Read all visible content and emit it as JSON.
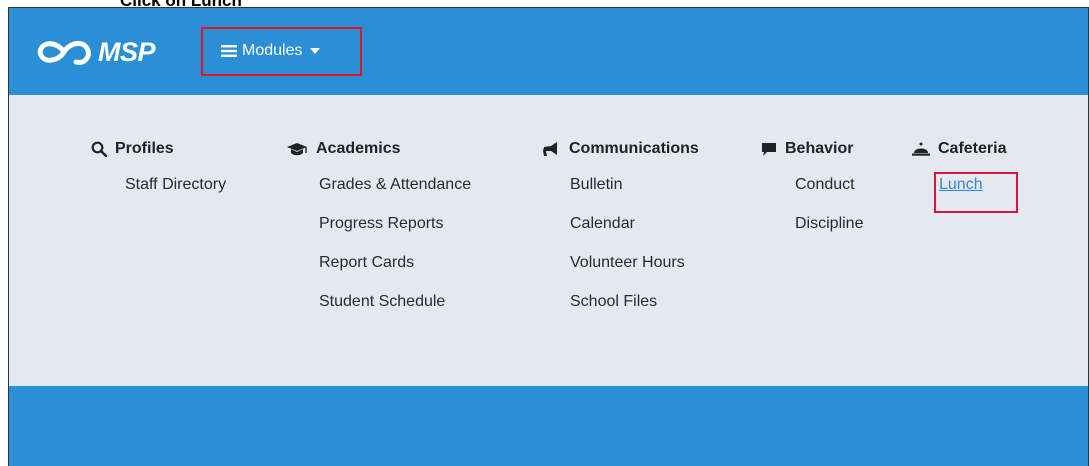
{
  "caption": "Click on Lunch",
  "brand": {
    "name": "MSP"
  },
  "navbar": {
    "modules_label": "Modules"
  },
  "colors": {
    "brand_blue": "#2b8fd5",
    "panel_bg": "#e4e9f1",
    "highlight": "#e0142c",
    "link": "#3a85d0"
  },
  "menu": {
    "profiles": {
      "title": "Profiles",
      "icon": "search-icon",
      "items": [
        "Staff Directory"
      ]
    },
    "academics": {
      "title": "Academics",
      "icon": "graduation-cap-icon",
      "items": [
        "Grades & Attendance",
        "Progress Reports",
        "Report Cards",
        "Student Schedule"
      ]
    },
    "communications": {
      "title": "Communications",
      "icon": "bullhorn-icon",
      "items": [
        "Bulletin",
        "Calendar",
        "Volunteer Hours",
        "School Files"
      ]
    },
    "behavior": {
      "title": "Behavior",
      "icon": "comment-icon",
      "items": [
        "Conduct",
        "Discipline"
      ]
    },
    "cafeteria": {
      "title": "Cafeteria",
      "icon": "cloche-icon",
      "items": [
        "Lunch"
      ]
    }
  }
}
